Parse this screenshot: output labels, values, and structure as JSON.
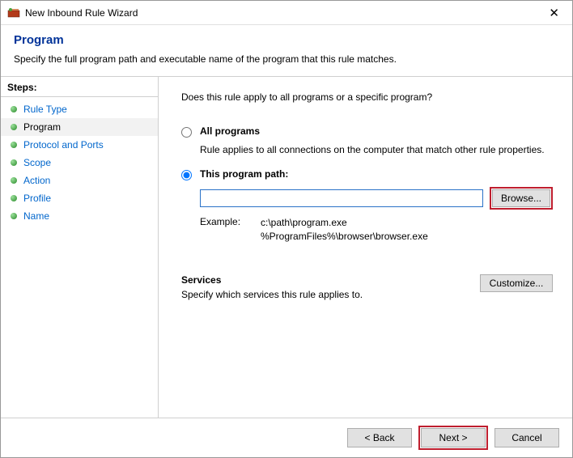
{
  "titlebar": {
    "text": "New Inbound Rule Wizard"
  },
  "header": {
    "title": "Program",
    "desc": "Specify the full program path and executable name of the program that this rule matches."
  },
  "sidebar": {
    "label": "Steps:",
    "items": [
      {
        "label": "Rule Type"
      },
      {
        "label": "Program"
      },
      {
        "label": "Protocol and Ports"
      },
      {
        "label": "Scope"
      },
      {
        "label": "Action"
      },
      {
        "label": "Profile"
      },
      {
        "label": "Name"
      }
    ]
  },
  "content": {
    "question": "Does this rule apply to all programs or a specific program?",
    "option1": {
      "label": "All programs",
      "desc": "Rule applies to all connections on the computer that match other rule properties."
    },
    "option2": {
      "label": "This program path:"
    },
    "path_value": "",
    "browse": "Browse...",
    "example_label": "Example:",
    "example_text1": "c:\\path\\program.exe",
    "example_text2": "%ProgramFiles%\\browser\\browser.exe",
    "services": {
      "title": "Services",
      "desc": "Specify which services this rule applies to.",
      "customize": "Customize..."
    }
  },
  "footer": {
    "back": "< Back",
    "next": "Next >",
    "cancel": "Cancel"
  }
}
